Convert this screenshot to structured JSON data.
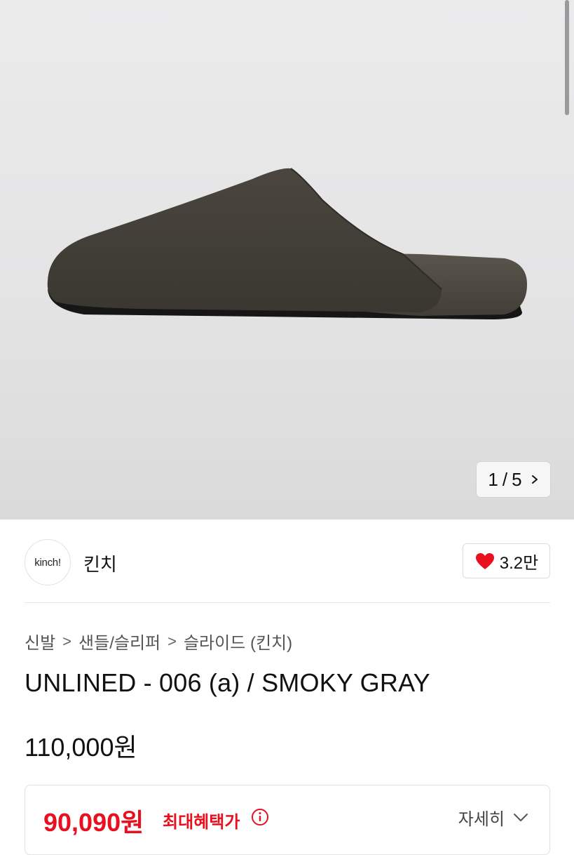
{
  "gallery": {
    "current": "1",
    "separator": "/",
    "total": "5",
    "image_alt": "smoky gray suede slide slipper"
  },
  "seller": {
    "logo_text": "kinch!",
    "name": "킨치",
    "like_count": "3.2만"
  },
  "breadcrumb": {
    "items": [
      "신발",
      "샌들/슬리퍼",
      "슬라이드 (킨치)"
    ],
    "separator": ">"
  },
  "product": {
    "title": "UNLINED - 006 (a) / SMOKY GRAY",
    "price": "110,000원"
  },
  "benefit": {
    "price": "90,090원",
    "label": "최대혜택가",
    "detail_label": "자세히"
  },
  "colors": {
    "accent_red": "#e8101f",
    "heart": "#e8101f"
  },
  "icons": {
    "pager_next": "chevron-right-icon",
    "like": "heart-icon",
    "info": "info-circle-icon",
    "detail_toggle": "chevron-down-icon"
  }
}
